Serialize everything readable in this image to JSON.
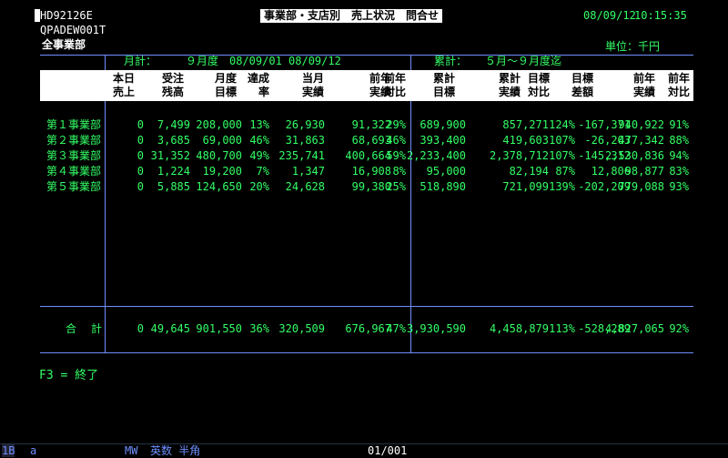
{
  "screen_id": "HD92126E",
  "program_id": "QPADEW001T",
  "scope": "全事業部",
  "title": "事業部・支店別　売上状況　問合せ",
  "date": "08/09/12",
  "time": "10:15:35",
  "unit": "単位：千円",
  "monthly_label": "月計：",
  "monthly_period": "９月度　08/09/01 08/09/12",
  "cumulative_label": "累計：",
  "cumulative_period": "５月～９月度迄",
  "headers": [
    [
      "本日",
      "売上"
    ],
    [
      "受注",
      "残高"
    ],
    [
      "月度",
      "目標"
    ],
    [
      "達成",
      "率"
    ],
    [
      "当月",
      "実績"
    ],
    [
      "前年",
      "実績"
    ],
    [
      "前年",
      "対比"
    ],
    [
      "累計",
      "目標"
    ],
    [
      "累計",
      "実績"
    ],
    [
      "目標",
      "対比"
    ],
    [
      "目標",
      "差額"
    ],
    [
      "前年",
      "実績"
    ],
    [
      "前年",
      "対比"
    ]
  ],
  "rows": [
    {
      "label": "第１事業部",
      "values": [
        "0",
        "7,499",
        "208,000",
        "13%",
        "26,930",
        "91,322",
        "29%",
        "689,900",
        "857,271",
        "124%",
        "-167,371",
        "940,922",
        "91%"
      ]
    },
    {
      "label": "第２事業部",
      "values": [
        "0",
        "3,685",
        "69,000",
        "46%",
        "31,863",
        "68,693",
        "46%",
        "393,400",
        "419,603",
        "107%",
        "-26,203",
        "477,342",
        "88%"
      ]
    },
    {
      "label": "第３事業部",
      "values": [
        "0",
        "31,352",
        "480,700",
        "49%",
        "235,741",
        "400,664",
        "59%",
        "2,233,400",
        "2,378,712",
        "107%",
        "-145,312",
        "2,530,836",
        "94%"
      ]
    },
    {
      "label": "第４事業部",
      "values": [
        "0",
        "1,224",
        "19,200",
        "7%",
        "1,347",
        "16,908",
        "8%",
        "95,000",
        "82,194",
        "87%",
        "12,806",
        "98,877",
        "83%"
      ]
    },
    {
      "label": "第５事業部",
      "values": [
        "0",
        "5,885",
        "124,650",
        "20%",
        "24,628",
        "99,380",
        "25%",
        "518,890",
        "721,099",
        "139%",
        "-202,209",
        "779,088",
        "93%"
      ]
    }
  ],
  "total": {
    "label": "合　計",
    "values": [
      "0",
      "49,645",
      "901,550",
      "36%",
      "320,509",
      "676,967",
      "47%",
      "3,930,590",
      "4,458,879",
      "113%",
      "-528,289",
      "4,827,065",
      "92%"
    ]
  },
  "fkey": "F3 = 終了",
  "status": {
    "left": "1B",
    "mode": "a",
    "mw": "MW",
    "ime": "英数 半角",
    "page": "01/001"
  }
}
